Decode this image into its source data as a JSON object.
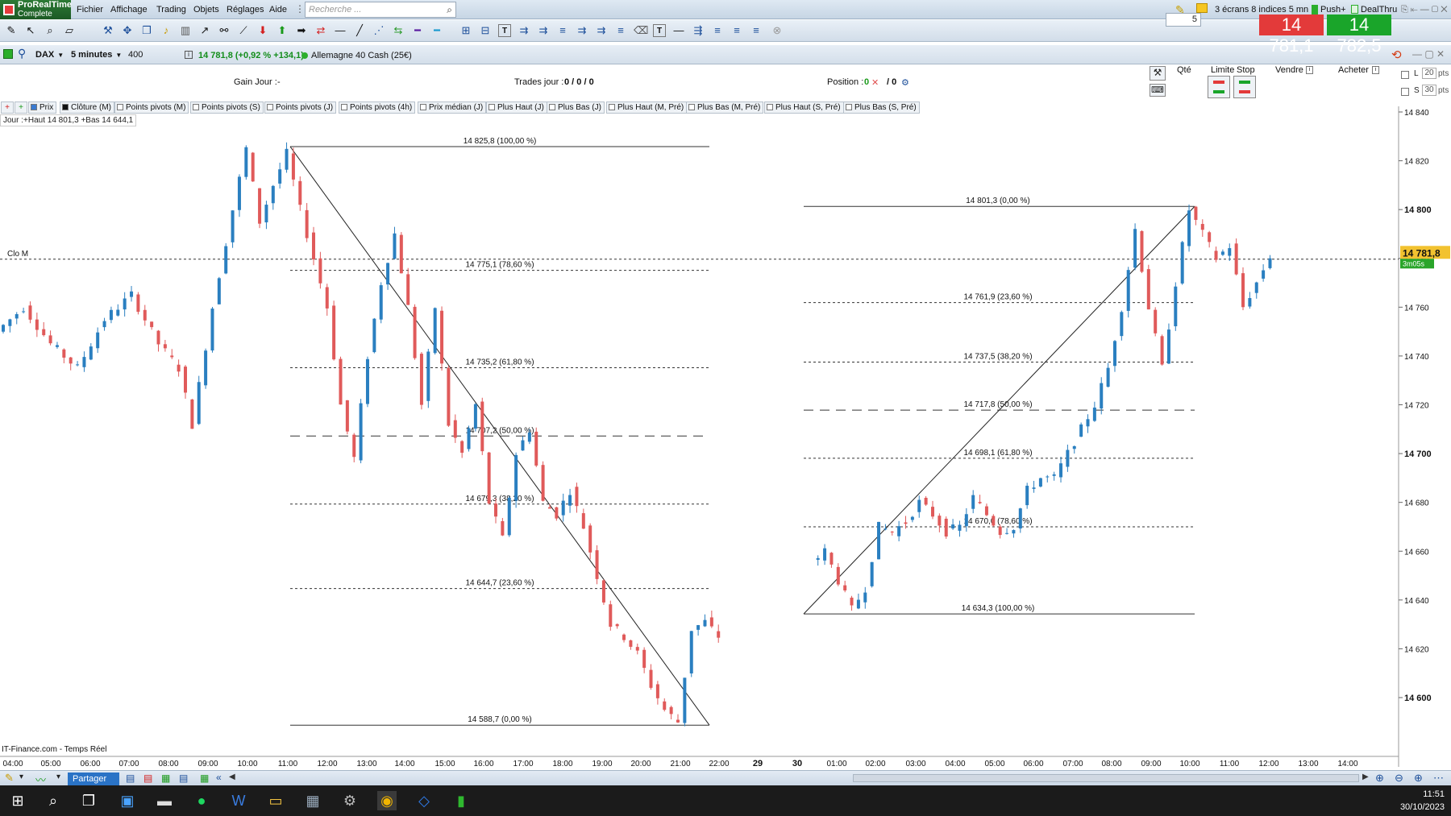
{
  "app": {
    "title_line1": "ProRealTime",
    "title_line2": "Complete"
  },
  "menu": [
    "Fichier",
    "Affichage",
    "Trading",
    "Objets",
    "Réglages",
    "Aide"
  ],
  "search": {
    "placeholder": "Recherche ..."
  },
  "topright": {
    "layout": "3 écrans 8 indices 5 mn",
    "push": "Push+",
    "dealthru": "DealThru"
  },
  "instrument": {
    "symbol": "DAX",
    "timeframe": "5 minutes",
    "units": "400 unités",
    "quote": "14 781,8 (+0,92 % +134,1)",
    "name": "Allemagne 40 Cash (25€)"
  },
  "info": {
    "gain_label": "Gain Jour :",
    "gain_value": "-",
    "trades_label": "Trades jour :",
    "trades_value": "0 / 0 / 0",
    "position_label": "Position :",
    "position_value": "0",
    "position_value2": "/ 0"
  },
  "order": {
    "qty_label": "Qté",
    "qty_value": "5",
    "limit_label": "Limite",
    "stop_label": "Stop",
    "sell_label": "Vendre",
    "buy_label": "Acheter",
    "sell_price": "14 781,1",
    "buy_price": "14 782,5",
    "l_label": "L",
    "s_label": "S",
    "l_pts": "20",
    "s_pts": "30",
    "pts": "pts"
  },
  "legend": [
    "Prix",
    "Clôture (M)",
    "Points pivots (M)",
    "Points pivots (S)",
    "Points pivots (J)",
    "Points pivots (4h)",
    "Prix médian (J)",
    "Plus Haut (J)",
    "Plus Bas (J)",
    "Plus Haut (M, Pré)",
    "Plus Bas (M, Pré)",
    "Plus Haut (S, Pré)",
    "Plus Bas (S, Pré)"
  ],
  "jour_label": "Jour :+Haut 14 801,3 +Bas 14 644,1",
  "clo_label": "Clo M",
  "source_label": "IT-Finance.com - Temps Réel",
  "status": {
    "share": "Partager"
  },
  "clock": {
    "time": "11:51",
    "date": "30/10/2023"
  },
  "chart_data": {
    "type": "candlestick",
    "price_axis": [
      "14 840",
      "14 820",
      "14 800",
      "14 780",
      "14 760",
      "14 740",
      "14 720",
      "14 700",
      "14 680",
      "14 660",
      "14 640",
      "14 620",
      "14 600"
    ],
    "price_axis_bold": [
      "14 800",
      "14 700",
      "14 600"
    ],
    "ylim": [
      14590,
      14845
    ],
    "time_axis": [
      "04:00",
      "05:00",
      "06:00",
      "07:00",
      "08:00",
      "09:00",
      "10:00",
      "11:00",
      "12:00",
      "13:00",
      "14:00",
      "15:00",
      "16:00",
      "17:00",
      "18:00",
      "19:00",
      "20:00",
      "21:00",
      "22:00",
      "29",
      "30",
      "01:00",
      "02:00",
      "03:00",
      "04:00",
      "05:00",
      "06:00",
      "07:00",
      "08:00",
      "09:00",
      "10:00",
      "11:00",
      "12:00",
      "13:00",
      "14:00"
    ],
    "current_price": "14 781,8",
    "current_timer": "3m05s",
    "close_level": 14780,
    "fib_down": {
      "high": 14825.8,
      "low": 14588.7,
      "labels": [
        "14 825,8 (100,00 %)",
        "14 775,1 (78,60 %)",
        "14 735,2 (61,80 %)",
        "14 707,2 (50,00 %)",
        "14 679,3 (38,20 %)",
        "14 644,7 (23,60 %)",
        "14 588,7 (0,00 %)"
      ],
      "values": [
        14825.8,
        14775.1,
        14735.2,
        14707.2,
        14679.3,
        14644.7,
        14588.7
      ]
    },
    "fib_up": {
      "high": 14801.3,
      "low": 14634.3,
      "labels": [
        "14 801,3 (0,00 %)",
        "14 761,9 (23,60 %)",
        "14 737,5 (38,20 %)",
        "14 717,8 (50,00 %)",
        "14 698,1 (61,80 %)",
        "14 670,0 (78,60 %)",
        "14 634,3 (100,00 %)"
      ],
      "values": [
        14801.3,
        14761.9,
        14737.5,
        14717.8,
        14698.1,
        14670.0,
        14634.3
      ]
    },
    "price_path": [
      [
        0,
        14750
      ],
      [
        4,
        14760
      ],
      [
        8,
        14745
      ],
      [
        12,
        14735
      ],
      [
        16,
        14755
      ],
      [
        20,
        14765
      ],
      [
        24,
        14745
      ],
      [
        27,
        14735
      ],
      [
        29,
        14712
      ],
      [
        32,
        14760
      ],
      [
        35,
        14800
      ],
      [
        37,
        14825
      ],
      [
        39,
        14795
      ],
      [
        41,
        14810
      ],
      [
        43,
        14823
      ],
      [
        45,
        14800
      ],
      [
        47,
        14780
      ],
      [
        49,
        14760
      ],
      [
        51,
        14720
      ],
      [
        53,
        14698
      ],
      [
        55,
        14740
      ],
      [
        57,
        14770
      ],
      [
        59,
        14790
      ],
      [
        61,
        14760
      ],
      [
        63,
        14720
      ],
      [
        65,
        14760
      ],
      [
        67,
        14712
      ],
      [
        69,
        14700
      ],
      [
        71,
        14720
      ],
      [
        73,
        14680
      ],
      [
        75,
        14665
      ],
      [
        77,
        14700
      ],
      [
        79,
        14710
      ],
      [
        81,
        14680
      ],
      [
        83,
        14675
      ],
      [
        85,
        14685
      ],
      [
        87,
        14670
      ],
      [
        89,
        14650
      ],
      [
        91,
        14630
      ],
      [
        93,
        14625
      ],
      [
        95,
        14618
      ],
      [
        97,
        14605
      ],
      [
        99,
        14595
      ],
      [
        101,
        14590
      ],
      [
        103,
        14628
      ],
      [
        105,
        14631
      ],
      [
        107,
        14625
      ],
      [
        110,
        14655
      ],
      [
        112,
        14660
      ],
      [
        114,
        14648
      ],
      [
        116,
        14636
      ],
      [
        118,
        14645
      ],
      [
        120,
        14670
      ],
      [
        122,
        14668
      ],
      [
        124,
        14672
      ],
      [
        126,
        14680
      ],
      [
        128,
        14675
      ],
      [
        130,
        14668
      ],
      [
        132,
        14670
      ],
      [
        134,
        14682
      ],
      [
        136,
        14675
      ],
      [
        138,
        14668
      ],
      [
        140,
        14670
      ],
      [
        142,
        14685
      ],
      [
        144,
        14690
      ],
      [
        146,
        14690
      ],
      [
        148,
        14700
      ],
      [
        150,
        14710
      ],
      [
        152,
        14720
      ],
      [
        154,
        14735
      ],
      [
        156,
        14760
      ],
      [
        158,
        14792
      ],
      [
        160,
        14760
      ],
      [
        162,
        14735
      ],
      [
        164,
        14770
      ],
      [
        166,
        14800
      ],
      [
        168,
        14790
      ],
      [
        170,
        14780
      ],
      [
        172,
        14785
      ],
      [
        174,
        14760
      ],
      [
        176,
        14770
      ],
      [
        178,
        14781
      ]
    ]
  }
}
